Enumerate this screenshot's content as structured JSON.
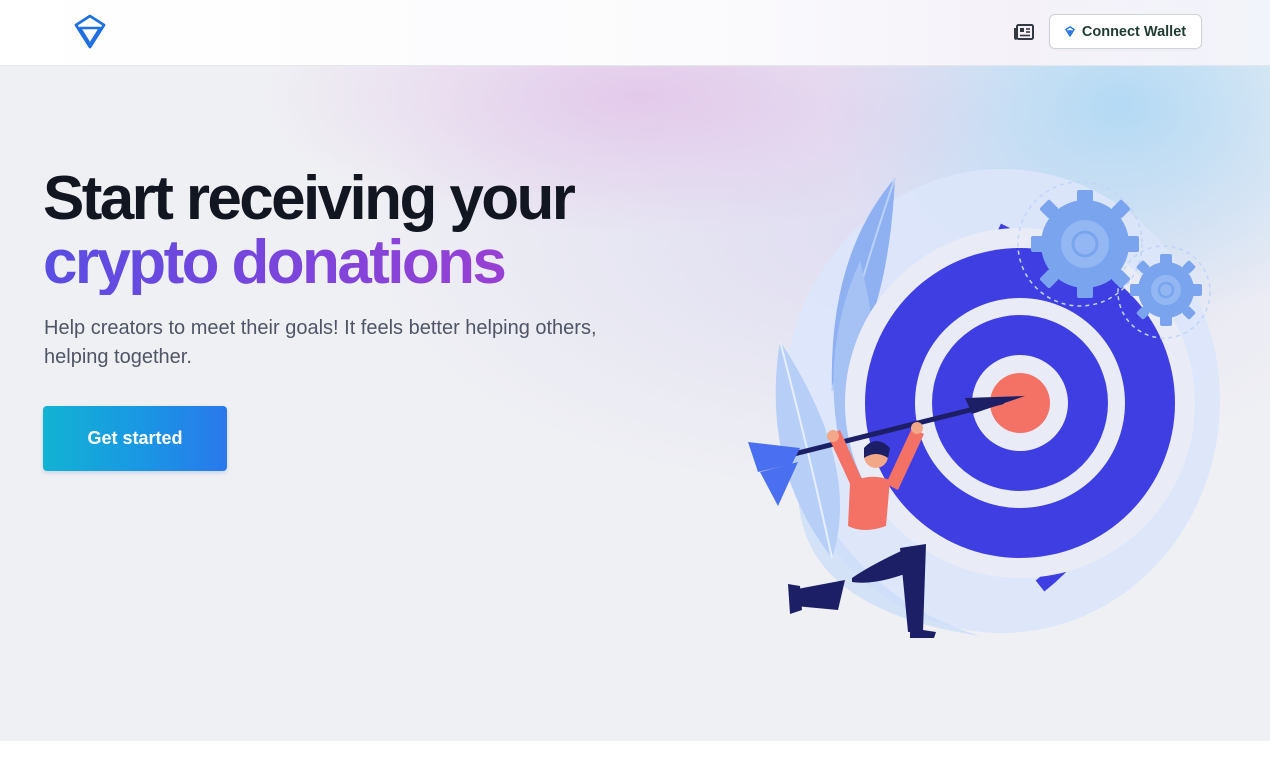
{
  "header": {
    "wallet_button_label": "Connect Wallet"
  },
  "hero": {
    "headline_line1": "Start receiving your",
    "headline_line2": "crypto donations",
    "subtitle": "Help creators to meet their goals! It feels better helping others, helping together.",
    "cta_label": "Get started"
  },
  "icons": {
    "logo": "diamond-logo-icon",
    "news": "newspaper-icon",
    "wallet": "gem-icon",
    "illustration": "target-archer-illustration"
  },
  "colors": {
    "brand_blue": "#1f6fe0",
    "accent_purple": "#7a45dc",
    "target_blue": "#3f3ee3",
    "target_center": "#f47166",
    "person_shirt": "#f47166",
    "cta_gradient_start": "#12b3d3",
    "cta_gradient_end": "#2a78ec"
  }
}
